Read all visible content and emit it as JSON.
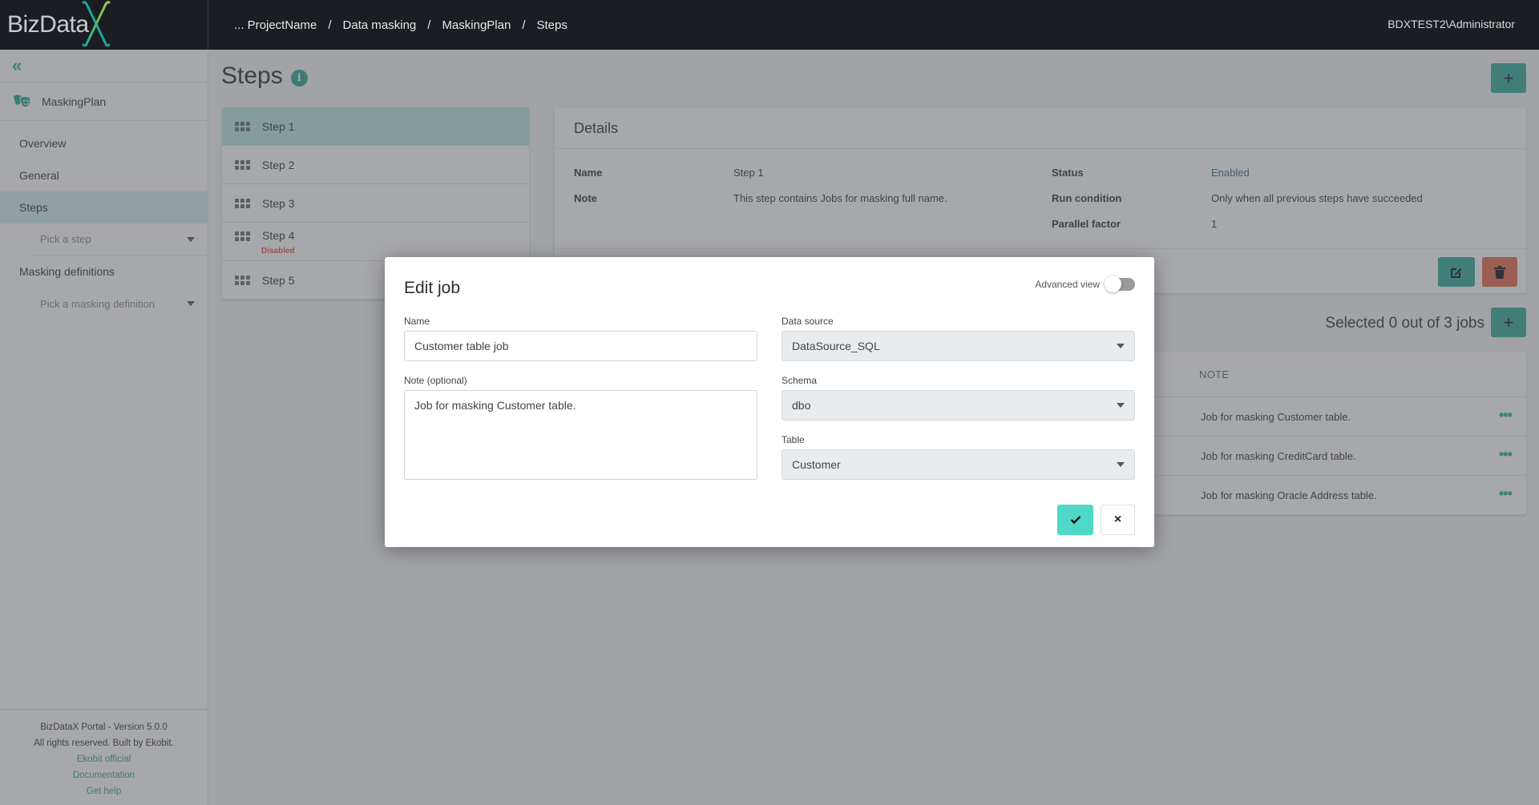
{
  "header": {
    "logo_text": "BizData",
    "breadcrumb": [
      "... ProjectName",
      "Data masking",
      "MaskingPlan",
      "Steps"
    ],
    "breadcrumb_separator": "/",
    "user": "BDXTEST2\\Administrator"
  },
  "sidebar": {
    "collapse_icon": "«",
    "plan_name": "MaskingPlan",
    "items": [
      {
        "label": "Overview",
        "active": false
      },
      {
        "label": "General",
        "active": false
      },
      {
        "label": "Steps",
        "active": true
      }
    ],
    "step_picker_placeholder": "Pick a step",
    "masking_definitions_label": "Masking definitions",
    "masking_picker_placeholder": "Pick a masking definition",
    "footer": {
      "version": "BizDataX Portal - Version 5.0.0",
      "rights": "All rights reserved. Built by Ekobit.",
      "links": [
        "Ekobit official",
        "Documentation",
        "Get help"
      ]
    }
  },
  "main": {
    "title": "Steps",
    "info_icon": "i",
    "add_label": "+",
    "steps": [
      {
        "label": "Step 1",
        "active": true,
        "sub": ""
      },
      {
        "label": "Step 2",
        "active": false,
        "sub": ""
      },
      {
        "label": "Step 3",
        "active": false,
        "sub": ""
      },
      {
        "label": "Step 4",
        "active": false,
        "sub": "Disabled"
      },
      {
        "label": "Step 5",
        "active": false,
        "sub": ""
      }
    ],
    "details": {
      "title": "Details",
      "name_label": "Name",
      "name_value": "Step 1",
      "note_label": "Note",
      "note_value": "This step contains Jobs for masking full name.",
      "status_label": "Status",
      "status_value": "Enabled",
      "run_condition_label": "Run condition",
      "run_condition_value": "Only when all previous steps have succeeded",
      "parallel_factor_label": "Parallel factor",
      "parallel_factor_value": "1"
    },
    "jobs": {
      "selection_text": "Selected 0 out of 3 jobs",
      "add_label": "+",
      "note_column": "NOTE",
      "rows": [
        {
          "note": "Job for masking Customer table.",
          "menu": "•••"
        },
        {
          "note": "Job for masking CreditCard table.",
          "menu": "•••"
        },
        {
          "note": "Job for masking Oracle Address table.",
          "menu": "•••"
        }
      ]
    }
  },
  "modal": {
    "title": "Edit job",
    "advanced_view_label": "Advanced view",
    "advanced_view_on": false,
    "name_label": "Name",
    "name_value": "Customer table job",
    "note_label": "Note (optional)",
    "note_value": "Job for masking Customer table.",
    "data_source_label": "Data source",
    "data_source_value": "DataSource_SQL",
    "schema_label": "Schema",
    "schema_value": "dbo",
    "table_label": "Table",
    "table_value": "Customer",
    "confirm_icon": "check",
    "cancel_icon": "×"
  },
  "colors": {
    "accent": "#34aa98",
    "danger": "#e46a4d",
    "confirm": "#4fd8c8",
    "header_bg": "#1b1d22",
    "disabled_text": "#e0503a"
  }
}
